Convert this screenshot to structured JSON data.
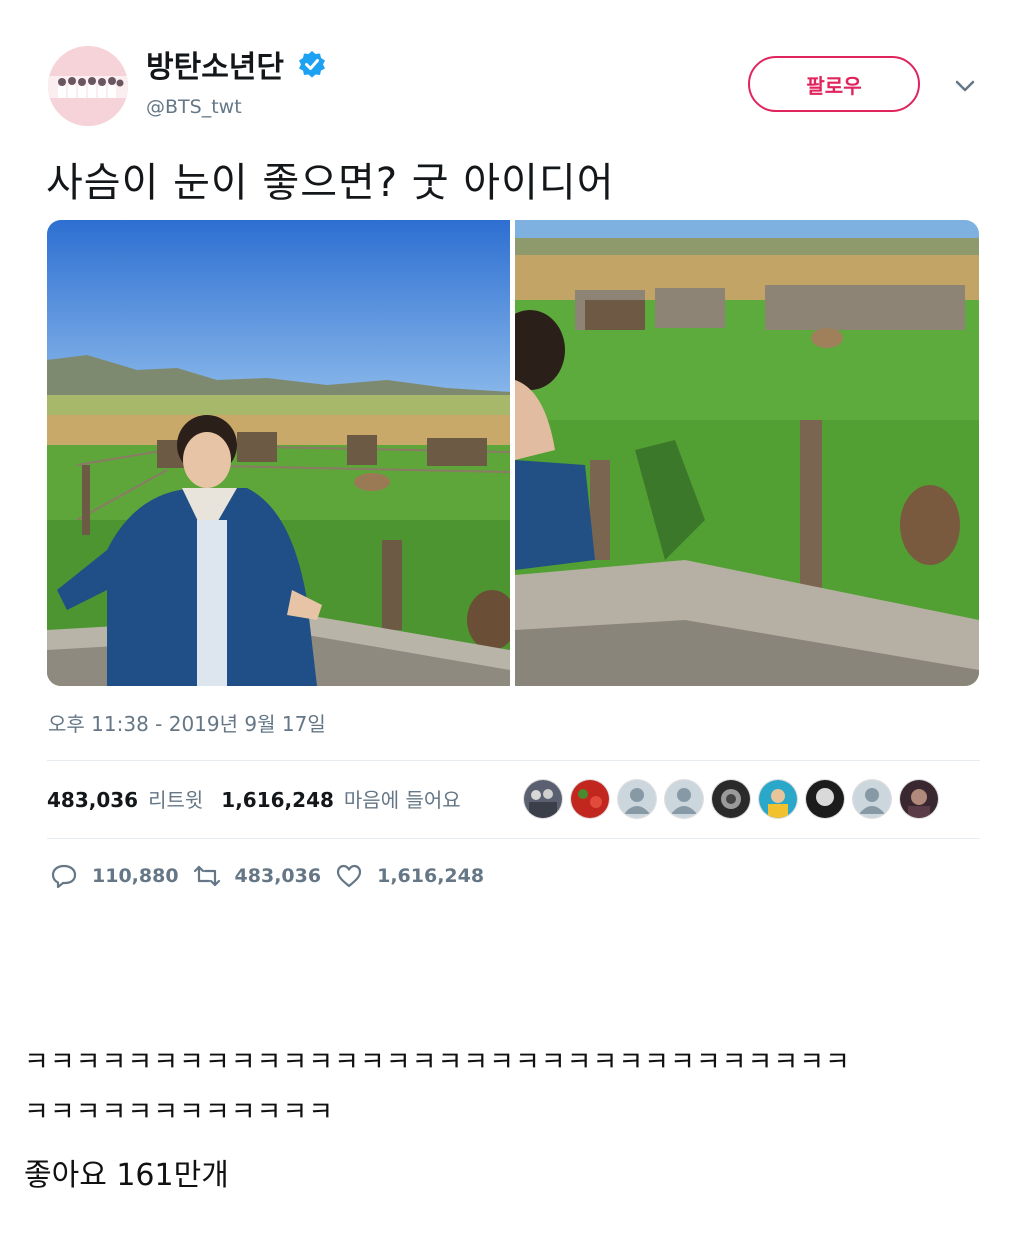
{
  "tweet": {
    "display_name": "방탄소년단",
    "handle": "@BTS_twt",
    "follow_label": "팔로우",
    "text": "사슴이 눈이 좋으면? 굿 아이디어",
    "timestamp": "오후 11:38 - 2019년 9월 17일",
    "stats": {
      "retweets_count": "483,036",
      "retweets_label": "리트윗",
      "likes_count": "1,616,248",
      "likes_label": "마음에 들어요"
    },
    "actions": {
      "reply_count": "110,880",
      "retweet_count": "483,036",
      "like_count": "1,616,248"
    },
    "icons": {
      "verified": "verified-badge-icon",
      "chevron": "chevron-down-icon",
      "reply": "reply-icon",
      "retweet": "retweet-icon",
      "like": "heart-icon"
    },
    "colors": {
      "follow": "#e0245e",
      "verified": "#1da1f2",
      "muted": "#657786"
    }
  },
  "caption": {
    "line1": "ㅋㅋㅋㅋㅋㅋㅋㅋㅋㅋㅋㅋㅋㅋㅋㅋㅋㅋㅋㅋㅋㅋㅋㅋㅋㅋㅋㅋㅋㅋㅋㅋ",
    "line2": "ㅋㅋㅋㅋㅋㅋㅋㅋㅋㅋㅋㅋ",
    "likes": "좋아요 161만개"
  }
}
